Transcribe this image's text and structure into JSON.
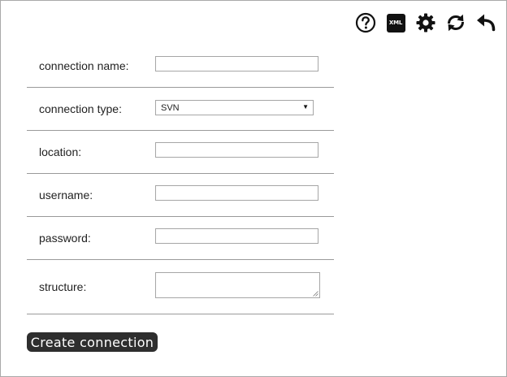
{
  "toolbar": {
    "icons": [
      "help-icon",
      "xml-icon",
      "gear-icon",
      "refresh-icon",
      "undo-icon"
    ],
    "xml_label": "XML"
  },
  "form": {
    "connection_name_label": "connection name:",
    "connection_name_value": "",
    "connection_type_label": "connection type:",
    "connection_type_value": "SVN",
    "location_label": "location:",
    "location_value": "",
    "username_label": "username:",
    "username_value": "",
    "password_label": "password:",
    "password_value": "",
    "structure_label": "structure:",
    "structure_value": ""
  },
  "actions": {
    "create_label": "Create connection"
  }
}
